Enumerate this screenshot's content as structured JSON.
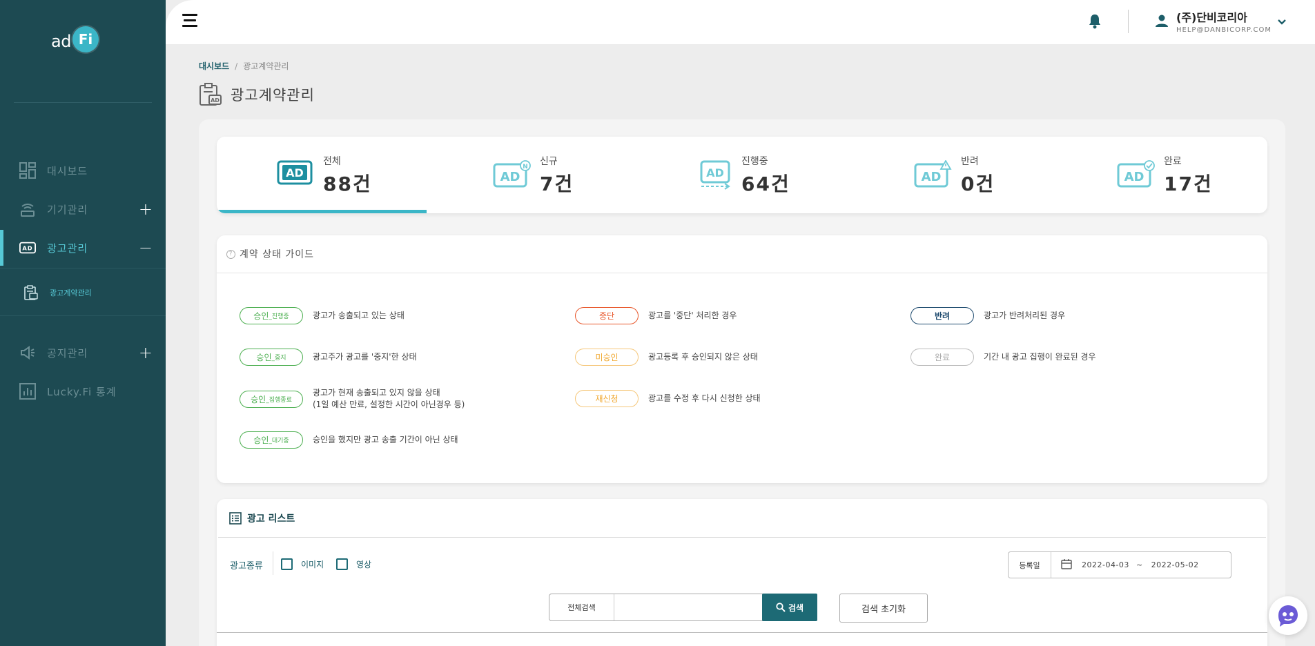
{
  "app": {
    "logo_text": "ad",
    "logo_badge": "Fi"
  },
  "sidebar": {
    "items": [
      {
        "label": "대시보드",
        "icon": "dashboard-icon",
        "expand": ""
      },
      {
        "label": "기기관리",
        "icon": "device-icon",
        "expand": "+"
      },
      {
        "label": "광고관리",
        "icon": "ad-icon",
        "expand": "−"
      },
      {
        "label": "공지관리",
        "icon": "megaphone-icon",
        "expand": "+"
      },
      {
        "label": "Lucky.Fi 통계",
        "icon": "stats-icon",
        "expand": ""
      }
    ],
    "sub_item": {
      "label": "광고계약관리",
      "icon": "contract-icon"
    }
  },
  "header": {
    "company": "(주)단비코리아",
    "email": "HELP@DANBICORP.COM"
  },
  "breadcrumb": {
    "home": "대시보드",
    "separator": "/",
    "current": "광고계약관리"
  },
  "page": {
    "title": "광고계약관리"
  },
  "stats": [
    {
      "label": "전체",
      "count": "88건",
      "icon": "ad-all-icon",
      "active": true
    },
    {
      "label": "신규",
      "count": "7건",
      "icon": "ad-new-icon",
      "active": false
    },
    {
      "label": "진행중",
      "count": "64건",
      "icon": "ad-progress-icon",
      "active": false
    },
    {
      "label": "반려",
      "count": "0건",
      "icon": "ad-reject-icon",
      "active": false
    },
    {
      "label": "완료",
      "count": "17건",
      "icon": "ad-complete-icon",
      "active": false
    }
  ],
  "guide": {
    "title": "계약 상태 가이드",
    "items": [
      {
        "badge": "승인",
        "sub": "_진행중",
        "desc": "광고가 송출되고 있는 상태",
        "color": "#4caf50"
      },
      {
        "badge": "승인",
        "sub": "_중지",
        "desc": "광고주가 광고를 '중지'한 상태",
        "color": "#4caf50"
      },
      {
        "badge": "승인",
        "sub": "_집행종료",
        "desc": "광고가 현재 송출되고 있지 않을 상태",
        "desc2": "(1일 예산 만료, 설정한 시간이 아닌경우 등)",
        "color": "#4caf50"
      },
      {
        "badge": "승인",
        "sub": "_대기중",
        "desc": "승인을 했지만 광고 송출 기간이 아닌 상태",
        "color": "#4caf50"
      },
      {
        "badge": "중단",
        "sub": "",
        "desc": "광고를 '중단' 처리한 경우",
        "color": "#e8562a"
      },
      {
        "badge": "미승인",
        "sub": "",
        "desc": "광고등록 후 승인되지 않은 상태",
        "color": "#f0a830"
      },
      {
        "badge": "재신청",
        "sub": "",
        "desc": "광고를 수정 후 다시 신청한 상태",
        "color": "#f0a830"
      },
      {
        "badge": "반려",
        "sub": "",
        "desc": "광고가 반려처리된 경우",
        "color": "#1d4a6e"
      },
      {
        "badge": "완료",
        "sub": "",
        "desc": "기간 내 광고 집행이 완료된 경우",
        "color": "#aaaaaa"
      }
    ]
  },
  "ad_list": {
    "title": "광고 리스트",
    "type_label": "광고종류",
    "checkbox_image": "이미지",
    "checkbox_video": "영상",
    "date_label": "등록일",
    "date_from": "2022-04-03",
    "date_sep": "~",
    "date_to": "2022-05-02",
    "search_select": "전체검색",
    "search_value": "",
    "search_button": "검색",
    "reset_button": "검색 초기화"
  }
}
